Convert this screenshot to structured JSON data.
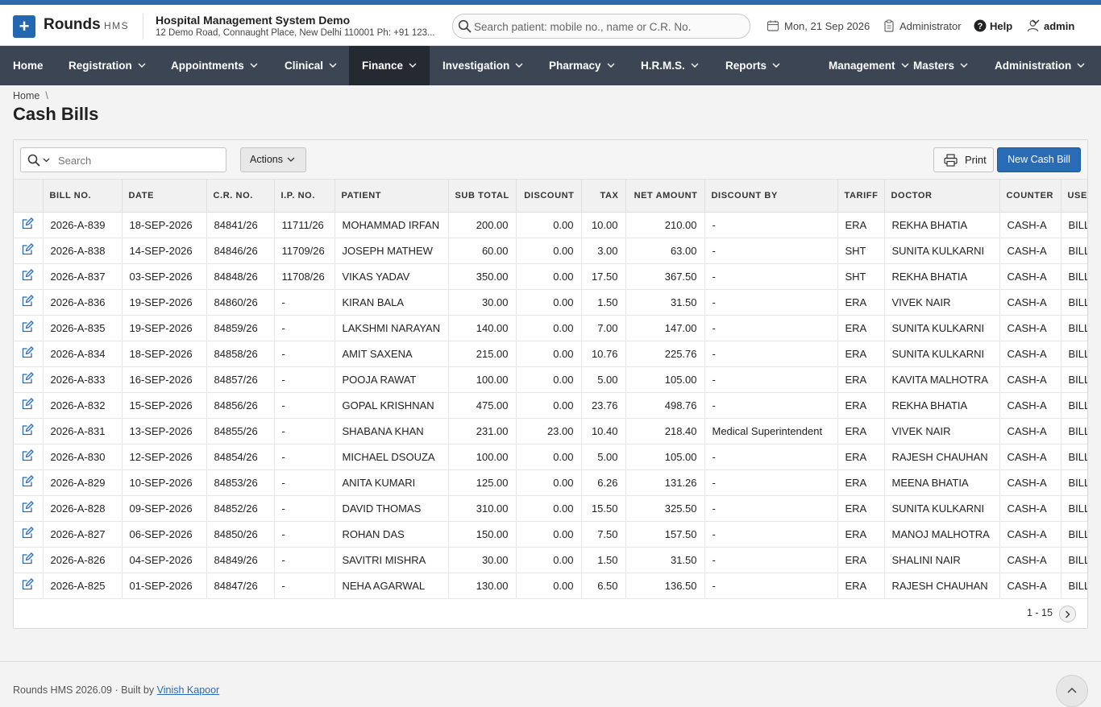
{
  "app": {
    "brand": "Rounds",
    "brand_sub": "HMS",
    "org_name": "Hospital Management System Demo",
    "org_address": "12 Demo Road, Connaught Place, New Delhi 110001 Ph: +91 123...",
    "search_placeholder": "Search patient: mobile no., name or C.R. No.",
    "date": "Mon, 21 Sep 2026",
    "role": "Administrator",
    "help": "Help",
    "user": "admin",
    "accent_color": "#2a6bb5",
    "nav_bg": "#3c4554"
  },
  "nav": [
    {
      "label": "Home",
      "dropdown": false,
      "active": false
    },
    {
      "label": "Registration",
      "dropdown": true,
      "active": false
    },
    {
      "label": "Appointments",
      "dropdown": true,
      "active": false
    },
    {
      "label": "Clinical",
      "dropdown": true,
      "active": false
    },
    {
      "label": "Finance",
      "dropdown": true,
      "active": true
    },
    {
      "label": "Investigation",
      "dropdown": true,
      "active": false
    },
    {
      "label": "Pharmacy",
      "dropdown": true,
      "active": false
    },
    {
      "label": "H.R.M.S.",
      "dropdown": true,
      "active": false
    },
    {
      "label": "Reports",
      "dropdown": true,
      "active": false
    },
    {
      "label": "Management",
      "dropdown": true,
      "active": false
    },
    {
      "label": "Masters",
      "dropdown": true,
      "active": false
    },
    {
      "label": "Administration",
      "dropdown": true,
      "active": false
    }
  ],
  "page": {
    "breadcrumb": "Home",
    "breadcrumb_sep": "\\",
    "title": "Cash Bills"
  },
  "toolbar": {
    "search_placeholder": "Search",
    "actions_label": "Actions",
    "print_label": "Print",
    "new_label": "New Cash Bill"
  },
  "table": {
    "columns": [
      "BILL NO.",
      "DATE",
      "C.R. NO.",
      "I.P. NO.",
      "PATIENT",
      "SUB TOTAL",
      "DISCOUNT",
      "TAX",
      "NET AMOUNT",
      "DISCOUNT BY",
      "TARIFF",
      "DOCTOR",
      "COUNTER",
      "USER"
    ],
    "rows": [
      [
        "2026-A-839",
        "18-SEP-2026",
        "84841/26",
        "11711/26",
        "MOHAMMAD IRFAN",
        "200.00",
        "0.00",
        "10.00",
        "210.00",
        "-",
        "ERA",
        "REKHA BHATIA",
        "CASH-A",
        "BILLING"
      ],
      [
        "2026-A-838",
        "14-SEP-2026",
        "84846/26",
        "11709/26",
        "JOSEPH MATHEW",
        "60.00",
        "0.00",
        "3.00",
        "63.00",
        "-",
        "SHT",
        "SUNITA KULKARNI",
        "CASH-A",
        "BILLING"
      ],
      [
        "2026-A-837",
        "03-SEP-2026",
        "84848/26",
        "11708/26",
        "VIKAS YADAV",
        "350.00",
        "0.00",
        "17.50",
        "367.50",
        "-",
        "SHT",
        "REKHA BHATIA",
        "CASH-A",
        "BILLING"
      ],
      [
        "2026-A-836",
        "19-SEP-2026",
        "84860/26",
        "-",
        "KIRAN BALA",
        "30.00",
        "0.00",
        "1.50",
        "31.50",
        "-",
        "ERA",
        "VIVEK NAIR",
        "CASH-A",
        "BILLING"
      ],
      [
        "2026-A-835",
        "19-SEP-2026",
        "84859/26",
        "-",
        "LAKSHMI NARAYAN",
        "140.00",
        "0.00",
        "7.00",
        "147.00",
        "-",
        "ERA",
        "SUNITA KULKARNI",
        "CASH-A",
        "BILLING"
      ],
      [
        "2026-A-834",
        "18-SEP-2026",
        "84858/26",
        "-",
        "AMIT SAXENA",
        "215.00",
        "0.00",
        "10.76",
        "225.76",
        "-",
        "ERA",
        "SUNITA KULKARNI",
        "CASH-A",
        "BILLING"
      ],
      [
        "2026-A-833",
        "16-SEP-2026",
        "84857/26",
        "-",
        "POOJA RAWAT",
        "100.00",
        "0.00",
        "5.00",
        "105.00",
        "-",
        "ERA",
        "KAVITA MALHOTRA",
        "CASH-A",
        "BILLING"
      ],
      [
        "2026-A-832",
        "15-SEP-2026",
        "84856/26",
        "-",
        "GOPAL KRISHNAN",
        "475.00",
        "0.00",
        "23.76",
        "498.76",
        "-",
        "ERA",
        "REKHA BHATIA",
        "CASH-A",
        "BILLING"
      ],
      [
        "2026-A-831",
        "13-SEP-2026",
        "84855/26",
        "-",
        "SHABANA KHAN",
        "231.00",
        "23.00",
        "10.40",
        "218.40",
        "Medical Superintendent",
        "ERA",
        "VIVEK NAIR",
        "CASH-A",
        "BILLING"
      ],
      [
        "2026-A-830",
        "12-SEP-2026",
        "84854/26",
        "-",
        "MICHAEL DSOUZA",
        "100.00",
        "0.00",
        "5.00",
        "105.00",
        "-",
        "ERA",
        "RAJESH CHAUHAN",
        "CASH-A",
        "BILLING"
      ],
      [
        "2026-A-829",
        "10-SEP-2026",
        "84853/26",
        "-",
        "ANITA KUMARI",
        "125.00",
        "0.00",
        "6.26",
        "131.26",
        "-",
        "ERA",
        "MEENA BHATIA",
        "CASH-A",
        "BILLING"
      ],
      [
        "2026-A-828",
        "09-SEP-2026",
        "84852/26",
        "-",
        "DAVID THOMAS",
        "310.00",
        "0.00",
        "15.50",
        "325.50",
        "-",
        "ERA",
        "SUNITA KULKARNI",
        "CASH-A",
        "BILLING"
      ],
      [
        "2026-A-827",
        "06-SEP-2026",
        "84850/26",
        "-",
        "ROHAN DAS",
        "150.00",
        "0.00",
        "7.50",
        "157.50",
        "-",
        "ERA",
        "MANOJ MALHOTRA",
        "CASH-A",
        "BILLING"
      ],
      [
        "2026-A-826",
        "04-SEP-2026",
        "84849/26",
        "-",
        "SAVITRI MISHRA",
        "30.00",
        "0.00",
        "1.50",
        "31.50",
        "-",
        "ERA",
        "SHALINI NAIR",
        "CASH-A",
        "BILLING"
      ],
      [
        "2026-A-825",
        "01-SEP-2026",
        "84847/26",
        "-",
        "NEHA AGARWAL",
        "130.00",
        "0.00",
        "6.50",
        "136.50",
        "-",
        "ERA",
        "RAJESH CHAUHAN",
        "CASH-A",
        "BILLING"
      ]
    ]
  },
  "pagination": {
    "range": "1 - 15"
  },
  "footer": {
    "version": "Rounds HMS 2026.09",
    "built_by_prefix": "Built by",
    "author": "Vinish Kapoor"
  },
  "icons": {
    "logo": "plus-icon",
    "search": "search-icon",
    "calendar": "calendar-icon",
    "role": "clipboard-icon",
    "help": "help-circle-icon",
    "user": "user-icon",
    "edit": "edit-icon",
    "print": "printer-icon",
    "next": "chevron-right-icon",
    "to_top": "chevron-up-icon"
  }
}
